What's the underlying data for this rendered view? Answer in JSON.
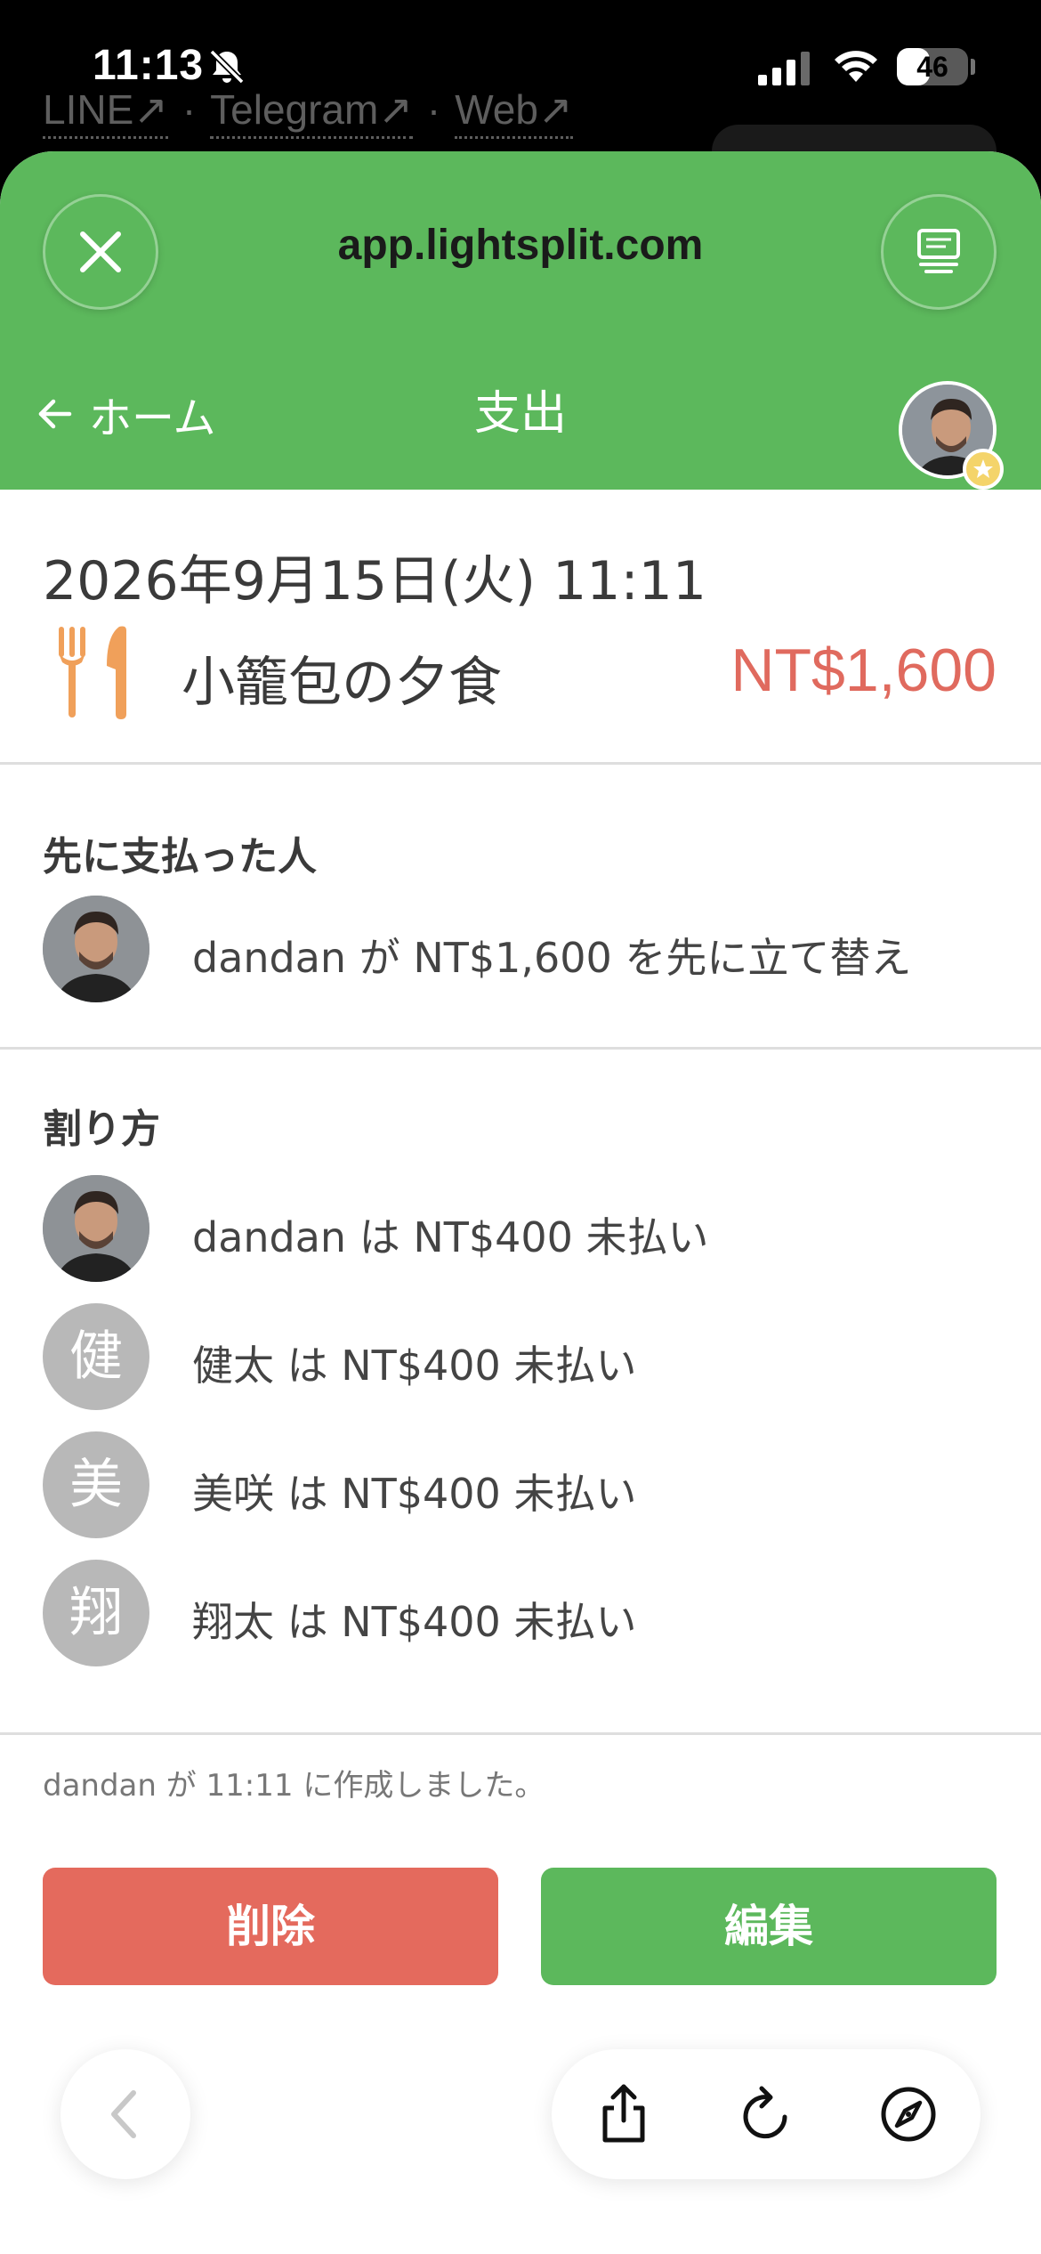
{
  "status_bar": {
    "time": "11:13",
    "battery": "46",
    "battery_level": 0.46
  },
  "behind_links": {
    "line": "LINE↗",
    "separator": "·",
    "telegram": "Telegram↗",
    "web": "Web↗"
  },
  "browser": {
    "url": "app.lightsplit.com"
  },
  "header": {
    "back_label": "ホーム",
    "title": "支出"
  },
  "expense": {
    "datetime": "2026年9月15日(火) 11:11",
    "category_icon": "fork-knife-icon",
    "name": "小籠包の夕食",
    "amount": "NT$1,600"
  },
  "paid_section": {
    "title": "先に支払った人",
    "payer_text": "dandan が NT$1,600 を先に立て替え"
  },
  "split_section": {
    "title": "割り方",
    "members": [
      {
        "initial": "",
        "text": "dandan は NT$400 未払い"
      },
      {
        "initial": "健",
        "text": "健太 は NT$400 未払い"
      },
      {
        "initial": "美",
        "text": "美咲 は NT$400 未払い"
      },
      {
        "initial": "翔",
        "text": "翔太 は NT$400 未払い"
      }
    ]
  },
  "created_note": "dandan が 11:11 に作成しました。",
  "actions": {
    "delete": "削除",
    "edit": "編集"
  },
  "colors": {
    "brand_green": "#5cb85c",
    "amount_red": "#e06a5e",
    "delete_red": "#e46a5d",
    "icon_orange": "#f0a05a"
  }
}
